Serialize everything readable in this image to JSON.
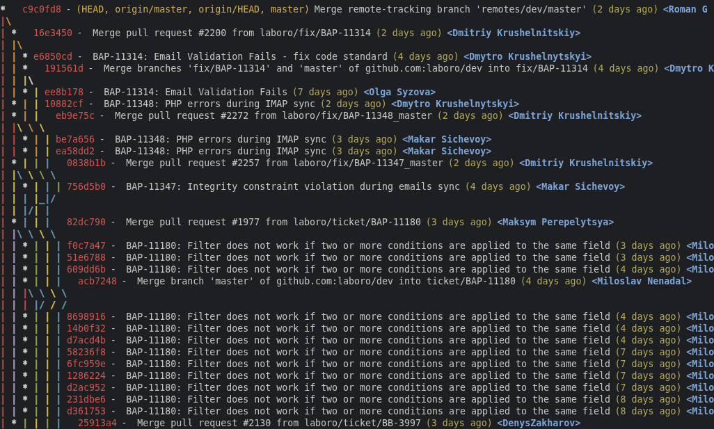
{
  "log_lines": [
    {
      "graph": [
        {
          "kind": "node",
          "text": "*   ",
          "color": "#d0d0d0"
        }
      ],
      "commit": {
        "hash": "c9c0fd8",
        "refs": "(HEAD, origin/master, origin/HEAD, master)",
        "subject": "-",
        "message": "Merge remote-tracking branch 'remotes/dev/master'",
        "date": "(2 days ago)",
        "author": "<Roman G"
      }
    },
    {
      "graph": [
        {
          "kind": "line",
          "text": "|",
          "color": "#b5473f"
        },
        {
          "kind": "line",
          "text": "\\",
          "color": "#c8873a"
        }
      ]
    },
    {
      "graph": [
        {
          "kind": "line",
          "text": "| ",
          "color": "#b5473f"
        },
        {
          "kind": "node",
          "text": "*   ",
          "color": "#d0d0d0"
        }
      ],
      "commit": {
        "hash": "16e3450",
        "subject": "- ",
        "message": "Merge pull request #2200 from laboro/fix/BAP-11314",
        "date": "(2 days ago)",
        "author": "<Dmitriy Krushelnitskiy>"
      }
    },
    {
      "graph": [
        {
          "kind": "line",
          "text": "| ",
          "color": "#b5473f"
        },
        {
          "kind": "line",
          "text": "|",
          "color": "#c8873a"
        },
        {
          "kind": "line",
          "text": "\\",
          "color": "#c8873a"
        }
      ]
    },
    {
      "graph": [
        {
          "kind": "line",
          "text": "| ",
          "color": "#b5473f"
        },
        {
          "kind": "line",
          "text": "| ",
          "color": "#c8873a"
        },
        {
          "kind": "node",
          "text": "* ",
          "color": "#d0d0d0"
        }
      ],
      "commit": {
        "hash": "e6850cd",
        "subject": "- ",
        "message": "BAP-11314: Email Validation Fails - fix code standard",
        "date": "(4 days ago)",
        "author": "<Dmytro Krushelnytskyi>"
      }
    },
    {
      "graph": [
        {
          "kind": "line",
          "text": "| ",
          "color": "#b5473f"
        },
        {
          "kind": "line",
          "text": "| ",
          "color": "#c8873a"
        },
        {
          "kind": "node",
          "text": "*   ",
          "color": "#d0d0d0"
        }
      ],
      "commit": {
        "hash": "191561d",
        "subject": "- ",
        "message": "Merge branches 'fix/BAP-11314' and 'master' of github.com:laboro/dev into fix/BAP-11314",
        "date": "(4 days ago)",
        "author": "<Dmytro K"
      }
    },
    {
      "graph": [
        {
          "kind": "line",
          "text": "| ",
          "color": "#b5473f"
        },
        {
          "kind": "line",
          "text": "| ",
          "color": "#c8873a"
        },
        {
          "kind": "line",
          "text": "|",
          "color": "#cdb548"
        },
        {
          "kind": "line",
          "text": "\\",
          "color": "#d0d0d0"
        }
      ]
    },
    {
      "graph": [
        {
          "kind": "line",
          "text": "| ",
          "color": "#b5473f"
        },
        {
          "kind": "line",
          "text": "| ",
          "color": "#c8873a"
        },
        {
          "kind": "node",
          "text": "* ",
          "color": "#d0d0d0"
        },
        {
          "kind": "line",
          "text": "| ",
          "color": "#cdb548"
        }
      ],
      "commit": {
        "hash": "ee8b178",
        "subject": "- ",
        "message": "BAP-11314: Email Validation Fails",
        "date": "(7 days ago)",
        "author": "<Olga Syzova>"
      }
    },
    {
      "graph": [
        {
          "kind": "line",
          "text": "| ",
          "color": "#b5473f"
        },
        {
          "kind": "node",
          "text": "* ",
          "color": "#d0d0d0"
        },
        {
          "kind": "line",
          "text": "| ",
          "color": "#c8873a"
        },
        {
          "kind": "line",
          "text": "| ",
          "color": "#cdb548"
        }
      ],
      "commit": {
        "hash": "10882cf",
        "subject": "- ",
        "message": "BAP-11348: PHP errors during IMAP sync",
        "date": "(2 days ago)",
        "author": "<Dmytro Krushelnytskyi>"
      }
    },
    {
      "graph": [
        {
          "kind": "line",
          "text": "| ",
          "color": "#b5473f"
        },
        {
          "kind": "node",
          "text": "* ",
          "color": "#d0d0d0"
        },
        {
          "kind": "line",
          "text": "| ",
          "color": "#c8873a"
        },
        {
          "kind": "line",
          "text": "|   ",
          "color": "#cdb548"
        }
      ],
      "commit": {
        "hash": "eb9e75c",
        "subject": "- ",
        "message": "Merge pull request #2272 from laboro/fix/BAP-11348_master",
        "date": "(2 days ago)",
        "author": "<Dmitriy Krushelnitskiy>"
      }
    },
    {
      "graph": [
        {
          "kind": "line",
          "text": "| ",
          "color": "#b5473f"
        },
        {
          "kind": "line",
          "text": "|",
          "color": "#c0463c"
        },
        {
          "kind": "line",
          "text": "\\ ",
          "color": "#cdb548"
        },
        {
          "kind": "line",
          "text": "\\ ",
          "color": "#c8873a"
        },
        {
          "kind": "line",
          "text": "\\",
          "color": "#cdb548"
        }
      ]
    },
    {
      "graph": [
        {
          "kind": "line",
          "text": "| ",
          "color": "#b5473f"
        },
        {
          "kind": "line",
          "text": "| ",
          "color": "#c0463c"
        },
        {
          "kind": "node",
          "text": "* ",
          "color": "#d0d0d0"
        },
        {
          "kind": "line",
          "text": "| ",
          "color": "#c8873a"
        },
        {
          "kind": "line",
          "text": "| ",
          "color": "#cdb548"
        }
      ],
      "commit": {
        "hash": "be7a656",
        "subject": "- ",
        "message": "BAP-11348: PHP errors during IMAP sync",
        "date": "(3 days ago)",
        "author": "<Makar Sichevoy>"
      }
    },
    {
      "graph": [
        {
          "kind": "line",
          "text": "| ",
          "color": "#b5473f"
        },
        {
          "kind": "line",
          "text": "| ",
          "color": "#c0463c"
        },
        {
          "kind": "node",
          "text": "* ",
          "color": "#d0d0d0"
        },
        {
          "kind": "line",
          "text": "| ",
          "color": "#c8873a"
        },
        {
          "kind": "line",
          "text": "| ",
          "color": "#cdb548"
        }
      ],
      "commit": {
        "hash": "ea58dd2",
        "subject": "- ",
        "message": "BAP-11348: PHP errors during IMAP sync",
        "date": "(3 days ago)",
        "author": "<Makar Sichevoy>"
      }
    },
    {
      "graph": [
        {
          "kind": "line",
          "text": "| ",
          "color": "#b5473f"
        },
        {
          "kind": "node",
          "text": "* ",
          "color": "#d0d0d0"
        },
        {
          "kind": "line",
          "text": "| ",
          "color": "#cdb548"
        },
        {
          "kind": "line",
          "text": "| ",
          "color": "#8f9a4c"
        },
        {
          "kind": "line",
          "text": "|   ",
          "color": "#5f93ab"
        }
      ],
      "commit": {
        "hash": "0838b1b",
        "subject": "- ",
        "message": "Merge pull request #2257 from laboro/fix/BAP-11347_master",
        "date": "(2 days ago)",
        "author": "<Dmitriy Krushelnitskiy>"
      }
    },
    {
      "graph": [
        {
          "kind": "line",
          "text": "| ",
          "color": "#b5473f"
        },
        {
          "kind": "line",
          "text": "|",
          "color": "#cdb548"
        },
        {
          "kind": "line",
          "text": "\\ ",
          "color": "#5f93ab"
        },
        {
          "kind": "line",
          "text": "\\ ",
          "color": "#cdb548"
        },
        {
          "kind": "line",
          "text": "\\ ",
          "color": "#8f9a4c"
        },
        {
          "kind": "line",
          "text": "\\",
          "color": "#5f93ab"
        }
      ]
    },
    {
      "graph": [
        {
          "kind": "line",
          "text": "| ",
          "color": "#b5473f"
        },
        {
          "kind": "line",
          "text": "| ",
          "color": "#cdb548"
        },
        {
          "kind": "node",
          "text": "* ",
          "color": "#d0d0d0"
        },
        {
          "kind": "line",
          "text": "| ",
          "color": "#cdb548"
        },
        {
          "kind": "line",
          "text": "| ",
          "color": "#5f93ab"
        },
        {
          "kind": "line",
          "text": "| ",
          "color": "#8f9a4c"
        }
      ],
      "commit": {
        "hash": "756d5b0",
        "subject": "- ",
        "message": "BAP-11347: Integrity constraint violation during emails sync",
        "date": "(4 days ago)",
        "author": "<Makar Sichevoy>"
      }
    },
    {
      "graph": [
        {
          "kind": "line",
          "text": "| ",
          "color": "#b5473f"
        },
        {
          "kind": "line",
          "text": "| ",
          "color": "#cdb548"
        },
        {
          "kind": "line",
          "text": "| ",
          "color": "#5f93ab"
        },
        {
          "kind": "line",
          "text": "|",
          "color": "#cdb548"
        },
        {
          "kind": "line",
          "text": "_",
          "color": "#5f93ab"
        },
        {
          "kind": "line",
          "text": "|",
          "color": "#5f93ab"
        },
        {
          "kind": "line",
          "text": "/",
          "color": "#5f93ab"
        }
      ]
    },
    {
      "graph": [
        {
          "kind": "line",
          "text": "| ",
          "color": "#b5473f"
        },
        {
          "kind": "line",
          "text": "| ",
          "color": "#cdb548"
        },
        {
          "kind": "line",
          "text": "|",
          "color": "#5f93ab"
        },
        {
          "kind": "line",
          "text": "/",
          "color": "#5f93ab"
        },
        {
          "kind": "line",
          "text": "| ",
          "color": "#cdb548"
        },
        {
          "kind": "line",
          "text": "|",
          "color": "#5f93ab"
        }
      ]
    },
    {
      "graph": [
        {
          "kind": "line",
          "text": "| ",
          "color": "#b5473f"
        },
        {
          "kind": "node",
          "text": "* ",
          "color": "#d0d0d0"
        },
        {
          "kind": "line",
          "text": "| ",
          "color": "#5f93ab"
        },
        {
          "kind": "line",
          "text": "| ",
          "color": "#cdb548"
        },
        {
          "kind": "line",
          "text": "|   ",
          "color": "#5f93ab"
        }
      ],
      "commit": {
        "hash": "82dc790",
        "subject": "- ",
        "message": "Merge pull request #1977 from laboro/ticket/BAP-11180",
        "date": "(3 days ago)",
        "author": "<Maksym Perepelytsya>"
      }
    },
    {
      "graph": [
        {
          "kind": "line",
          "text": "| ",
          "color": "#b5473f"
        },
        {
          "kind": "line",
          "text": "|",
          "color": "#a893c4"
        },
        {
          "kind": "line",
          "text": "\\ ",
          "color": "#5f93ab"
        },
        {
          "kind": "line",
          "text": "\\ ",
          "color": "#5f93ab"
        },
        {
          "kind": "line",
          "text": "\\ ",
          "color": "#cdb548"
        },
        {
          "kind": "line",
          "text": "\\",
          "color": "#5f93ab"
        }
      ]
    },
    {
      "graph": [
        {
          "kind": "line",
          "text": "| ",
          "color": "#b5473f"
        },
        {
          "kind": "line",
          "text": "| ",
          "color": "#a893c4"
        },
        {
          "kind": "node",
          "text": "* ",
          "color": "#d0d0d0"
        },
        {
          "kind": "line",
          "text": "| ",
          "color": "#8f9a4c"
        },
        {
          "kind": "line",
          "text": "| ",
          "color": "#cdb548"
        },
        {
          "kind": "line",
          "text": "| ",
          "color": "#5f93ab"
        }
      ],
      "commit": {
        "hash": "f0c7a47",
        "subject": "- ",
        "message": "BAP-11180: Filter does not work if two or more conditions are applied to the same field",
        "date": "(3 days ago)",
        "author": "<Milo"
      }
    },
    {
      "graph": [
        {
          "kind": "line",
          "text": "| ",
          "color": "#b5473f"
        },
        {
          "kind": "line",
          "text": "| ",
          "color": "#a893c4"
        },
        {
          "kind": "node",
          "text": "* ",
          "color": "#d0d0d0"
        },
        {
          "kind": "line",
          "text": "| ",
          "color": "#8f9a4c"
        },
        {
          "kind": "line",
          "text": "| ",
          "color": "#cdb548"
        },
        {
          "kind": "line",
          "text": "| ",
          "color": "#5f93ab"
        }
      ],
      "commit": {
        "hash": "51e6788",
        "subject": "- ",
        "message": "BAP-11180: Filter does not work if two or more conditions are applied to the same field",
        "date": "(3 days ago)",
        "author": "<Milo"
      }
    },
    {
      "graph": [
        {
          "kind": "line",
          "text": "| ",
          "color": "#b5473f"
        },
        {
          "kind": "line",
          "text": "| ",
          "color": "#a893c4"
        },
        {
          "kind": "node",
          "text": "* ",
          "color": "#d0d0d0"
        },
        {
          "kind": "line",
          "text": "| ",
          "color": "#8f9a4c"
        },
        {
          "kind": "line",
          "text": "| ",
          "color": "#cdb548"
        },
        {
          "kind": "line",
          "text": "| ",
          "color": "#5f93ab"
        }
      ],
      "commit": {
        "hash": "609dd6b",
        "subject": "- ",
        "message": "BAP-11180: Filter does not work if two or more conditions are applied to the same field",
        "date": "(4 days ago)",
        "author": "<Milo"
      }
    },
    {
      "graph": [
        {
          "kind": "line",
          "text": "| ",
          "color": "#b5473f"
        },
        {
          "kind": "line",
          "text": "| ",
          "color": "#a893c4"
        },
        {
          "kind": "node",
          "text": "* ",
          "color": "#d0d0d0"
        },
        {
          "kind": "line",
          "text": "| ",
          "color": "#8f9a4c"
        },
        {
          "kind": "line",
          "text": "| ",
          "color": "#cdb548"
        },
        {
          "kind": "line",
          "text": "|   ",
          "color": "#5f93ab"
        }
      ],
      "commit": {
        "hash": "acb7248",
        "subject": "- ",
        "message": "Merge branch 'master' of github.com:laboro/dev into ticket/BAP-11180",
        "date": "(4 days ago)",
        "author": "<Miloslav Nenadal>"
      }
    },
    {
      "graph": [
        {
          "kind": "line",
          "text": "| ",
          "color": "#b5473f"
        },
        {
          "kind": "line",
          "text": "| ",
          "color": "#a893c4"
        },
        {
          "kind": "line",
          "text": "|",
          "color": "#c0463c"
        },
        {
          "kind": "line",
          "text": "\\ ",
          "color": "#5f93ab"
        },
        {
          "kind": "line",
          "text": "\\ ",
          "color": "#5f93ab"
        },
        {
          "kind": "line",
          "text": "\\ ",
          "color": "#cdb548"
        },
        {
          "kind": "line",
          "text": "\\",
          "color": "#5f93ab"
        }
      ]
    },
    {
      "graph": [
        {
          "kind": "line",
          "text": "| ",
          "color": "#b5473f"
        },
        {
          "kind": "line",
          "text": "| ",
          "color": "#a893c4"
        },
        {
          "kind": "line",
          "text": "| ",
          "color": "#c0463c"
        },
        {
          "kind": "line",
          "text": "|",
          "color": "#5f93ab"
        },
        {
          "kind": "line",
          "text": "/ ",
          "color": "#5f93ab"
        },
        {
          "kind": "line",
          "text": "/ ",
          "color": "#cdb548"
        },
        {
          "kind": "line",
          "text": "/",
          "color": "#5f93ab"
        }
      ]
    },
    {
      "graph": [
        {
          "kind": "line",
          "text": "| ",
          "color": "#b5473f"
        },
        {
          "kind": "line",
          "text": "| ",
          "color": "#a893c4"
        },
        {
          "kind": "node",
          "text": "* ",
          "color": "#d0d0d0"
        },
        {
          "kind": "line",
          "text": "| ",
          "color": "#8f9a4c"
        },
        {
          "kind": "line",
          "text": "| ",
          "color": "#cdb548"
        },
        {
          "kind": "line",
          "text": "| ",
          "color": "#5f93ab"
        }
      ],
      "commit": {
        "hash": "8698916",
        "subject": "- ",
        "message": "BAP-11180: Filter does not work if two or more conditions are applied to the same field",
        "date": "(4 days ago)",
        "author": "<Milo"
      }
    },
    {
      "graph": [
        {
          "kind": "line",
          "text": "| ",
          "color": "#b5473f"
        },
        {
          "kind": "line",
          "text": "| ",
          "color": "#a893c4"
        },
        {
          "kind": "node",
          "text": "* ",
          "color": "#d0d0d0"
        },
        {
          "kind": "line",
          "text": "| ",
          "color": "#8f9a4c"
        },
        {
          "kind": "line",
          "text": "| ",
          "color": "#cdb548"
        },
        {
          "kind": "line",
          "text": "| ",
          "color": "#5f93ab"
        }
      ],
      "commit": {
        "hash": "14b0f32",
        "subject": "- ",
        "message": "BAP-11180: Filter does not work if two or more conditions are applied to the same field",
        "date": "(4 days ago)",
        "author": "<Milo"
      }
    },
    {
      "graph": [
        {
          "kind": "line",
          "text": "| ",
          "color": "#b5473f"
        },
        {
          "kind": "line",
          "text": "| ",
          "color": "#a893c4"
        },
        {
          "kind": "node",
          "text": "* ",
          "color": "#d0d0d0"
        },
        {
          "kind": "line",
          "text": "| ",
          "color": "#8f9a4c"
        },
        {
          "kind": "line",
          "text": "| ",
          "color": "#cdb548"
        },
        {
          "kind": "line",
          "text": "| ",
          "color": "#5f93ab"
        }
      ],
      "commit": {
        "hash": "d7acd4b",
        "subject": "- ",
        "message": "BAP-11180: Filter does not work if two or more conditions are applied to the same field",
        "date": "(4 days ago)",
        "author": "<Milo"
      }
    },
    {
      "graph": [
        {
          "kind": "line",
          "text": "| ",
          "color": "#b5473f"
        },
        {
          "kind": "line",
          "text": "| ",
          "color": "#a893c4"
        },
        {
          "kind": "node",
          "text": "* ",
          "color": "#d0d0d0"
        },
        {
          "kind": "line",
          "text": "| ",
          "color": "#8f9a4c"
        },
        {
          "kind": "line",
          "text": "| ",
          "color": "#cdb548"
        },
        {
          "kind": "line",
          "text": "| ",
          "color": "#5f93ab"
        }
      ],
      "commit": {
        "hash": "58236f8",
        "subject": "- ",
        "message": "BAP-11180: Filter does not work if two or more conditions are applied to the same field",
        "date": "(7 days ago)",
        "author": "<Milo"
      }
    },
    {
      "graph": [
        {
          "kind": "line",
          "text": "| ",
          "color": "#b5473f"
        },
        {
          "kind": "line",
          "text": "| ",
          "color": "#a893c4"
        },
        {
          "kind": "node",
          "text": "* ",
          "color": "#d0d0d0"
        },
        {
          "kind": "line",
          "text": "| ",
          "color": "#8f9a4c"
        },
        {
          "kind": "line",
          "text": "| ",
          "color": "#cdb548"
        },
        {
          "kind": "line",
          "text": "| ",
          "color": "#5f93ab"
        }
      ],
      "commit": {
        "hash": "6fc959e",
        "subject": "- ",
        "message": "BAP-11180: Filter does not work if two or more conditions are applied to the same field",
        "date": "(7 days ago)",
        "author": "<Milo"
      }
    },
    {
      "graph": [
        {
          "kind": "line",
          "text": "| ",
          "color": "#b5473f"
        },
        {
          "kind": "line",
          "text": "| ",
          "color": "#a893c4"
        },
        {
          "kind": "node",
          "text": "* ",
          "color": "#d0d0d0"
        },
        {
          "kind": "line",
          "text": "| ",
          "color": "#8f9a4c"
        },
        {
          "kind": "line",
          "text": "| ",
          "color": "#cdb548"
        },
        {
          "kind": "line",
          "text": "| ",
          "color": "#5f93ab"
        }
      ],
      "commit": {
        "hash": "1286224",
        "subject": "- ",
        "message": "BAP-11180: Filter does not work if two or more conditions are applied to the same field",
        "date": "(7 days ago)",
        "author": "<Milo"
      }
    },
    {
      "graph": [
        {
          "kind": "line",
          "text": "| ",
          "color": "#b5473f"
        },
        {
          "kind": "line",
          "text": "| ",
          "color": "#a893c4"
        },
        {
          "kind": "node",
          "text": "* ",
          "color": "#d0d0d0"
        },
        {
          "kind": "line",
          "text": "| ",
          "color": "#8f9a4c"
        },
        {
          "kind": "line",
          "text": "| ",
          "color": "#cdb548"
        },
        {
          "kind": "line",
          "text": "| ",
          "color": "#5f93ab"
        }
      ],
      "commit": {
        "hash": "d2ac952",
        "subject": "- ",
        "message": "BAP-11180: Filter does not work if two or more conditions are applied to the same field",
        "date": "(7 days ago)",
        "author": "<Milo"
      }
    },
    {
      "graph": [
        {
          "kind": "line",
          "text": "| ",
          "color": "#b5473f"
        },
        {
          "kind": "line",
          "text": "| ",
          "color": "#a893c4"
        },
        {
          "kind": "node",
          "text": "* ",
          "color": "#d0d0d0"
        },
        {
          "kind": "line",
          "text": "| ",
          "color": "#8f9a4c"
        },
        {
          "kind": "line",
          "text": "| ",
          "color": "#cdb548"
        },
        {
          "kind": "line",
          "text": "| ",
          "color": "#5f93ab"
        }
      ],
      "commit": {
        "hash": "231dbe6",
        "subject": "- ",
        "message": "BAP-11180: Filter does not work if two or more conditions are applied to the same field",
        "date": "(8 days ago)",
        "author": "<Milo"
      }
    },
    {
      "graph": [
        {
          "kind": "line",
          "text": "| ",
          "color": "#b5473f"
        },
        {
          "kind": "line",
          "text": "| ",
          "color": "#a893c4"
        },
        {
          "kind": "node",
          "text": "* ",
          "color": "#d0d0d0"
        },
        {
          "kind": "line",
          "text": "| ",
          "color": "#8f9a4c"
        },
        {
          "kind": "line",
          "text": "| ",
          "color": "#cdb548"
        },
        {
          "kind": "line",
          "text": "| ",
          "color": "#5f93ab"
        }
      ],
      "commit": {
        "hash": "d361753",
        "subject": "- ",
        "message": "BAP-11180: Filter does not work if two or more conditions are applied to the same field",
        "date": "(8 days ago)",
        "author": "<Milo"
      }
    },
    {
      "graph": [
        {
          "kind": "line",
          "text": "| ",
          "color": "#b5473f"
        },
        {
          "kind": "node",
          "text": "* ",
          "color": "#d0d0d0"
        },
        {
          "kind": "line",
          "text": "| ",
          "color": "#8f9a4c"
        },
        {
          "kind": "line",
          "text": "| ",
          "color": "#cdb548"
        },
        {
          "kind": "line",
          "text": "| ",
          "color": "#8f9a4c"
        },
        {
          "kind": "line",
          "text": "|   ",
          "color": "#5f93ab"
        }
      ],
      "commit": {
        "hash": "25913a4",
        "subject": "- ",
        "message": "Merge pull request #2130 from laboro/ticket/BB-3997",
        "date": "(3 days ago)",
        "author": "<DenysZakharov>"
      }
    }
  ]
}
